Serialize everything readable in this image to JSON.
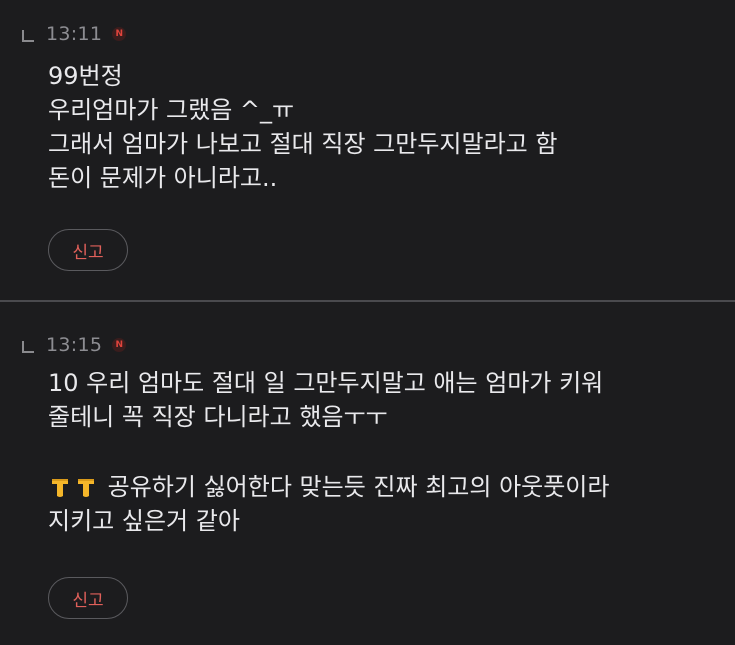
{
  "replies": [
    {
      "time": "13:11",
      "badge": "N",
      "lines": [
        "99번정",
        "우리엄마가 그랬음 ^_ㅠ",
        "그래서 엄마가 나보고 절대 직장 그만두지말라고 함",
        "돈이 문제가 아니라고.."
      ],
      "report_label": "신고"
    },
    {
      "time": "13:15",
      "badge": "N",
      "lines": [
        "10 우리 엄마도 절대 일 그만두지말고 애는 엄마가 키워",
        "줄테니 꼭 직장 다니라고 했음ㅜㅜ",
        "",
        "공유하기 싫어한다 맞는듯 진짜 최고의 아웃풋이라",
        "지키고 싶은거 같아"
      ],
      "emoji_names": [
        "pointing-down-hand-icon",
        "pointing-down-hand-icon"
      ],
      "report_label": "신고"
    }
  ],
  "colors": {
    "background": "#1c1c1e",
    "text": "#e9e9ec",
    "meta": "#8d8d92",
    "report": "#e0605a",
    "badge": "#e0443c"
  }
}
